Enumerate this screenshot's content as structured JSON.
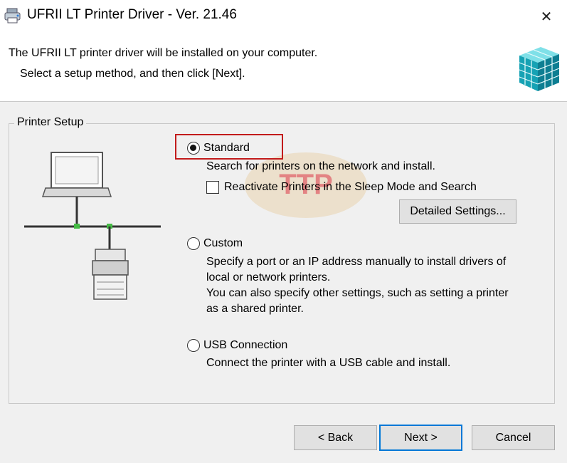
{
  "window": {
    "title": "UFRII LT Printer Driver - Ver. 21.46",
    "close_glyph": "✕"
  },
  "header": {
    "instruction_line1": "The UFRII LT printer driver will be installed on your computer.",
    "instruction_line2": "Select a setup method, and then click [Next]."
  },
  "group": {
    "legend": "Printer Setup"
  },
  "options": {
    "standard": {
      "label": "Standard",
      "description": "Search for printers on the network and install.",
      "checked": true
    },
    "reactivate": {
      "label": "Reactivate Printers in the Sleep Mode and Search",
      "checked": false
    },
    "detailed_settings_label": "Detailed Settings...",
    "custom": {
      "label": "Custom",
      "description_line1": "Specify a port or an IP address manually to install drivers of",
      "description_line2": "local or network printers.",
      "description_line3": "You can also specify other settings, such as setting a printer",
      "description_line4": "as a shared printer.",
      "checked": false
    },
    "usb": {
      "label": "USB Connection",
      "description": "Connect the printer with a USB cable and install.",
      "checked": false
    }
  },
  "buttons": {
    "back": "< Back",
    "next": "Next >",
    "cancel": "Cancel"
  },
  "watermark": {
    "text": "TTP"
  },
  "colors": {
    "highlight_border": "#c21b1b",
    "default_button_border": "#0078d7",
    "graphic_teal": "#1ab2c0"
  }
}
